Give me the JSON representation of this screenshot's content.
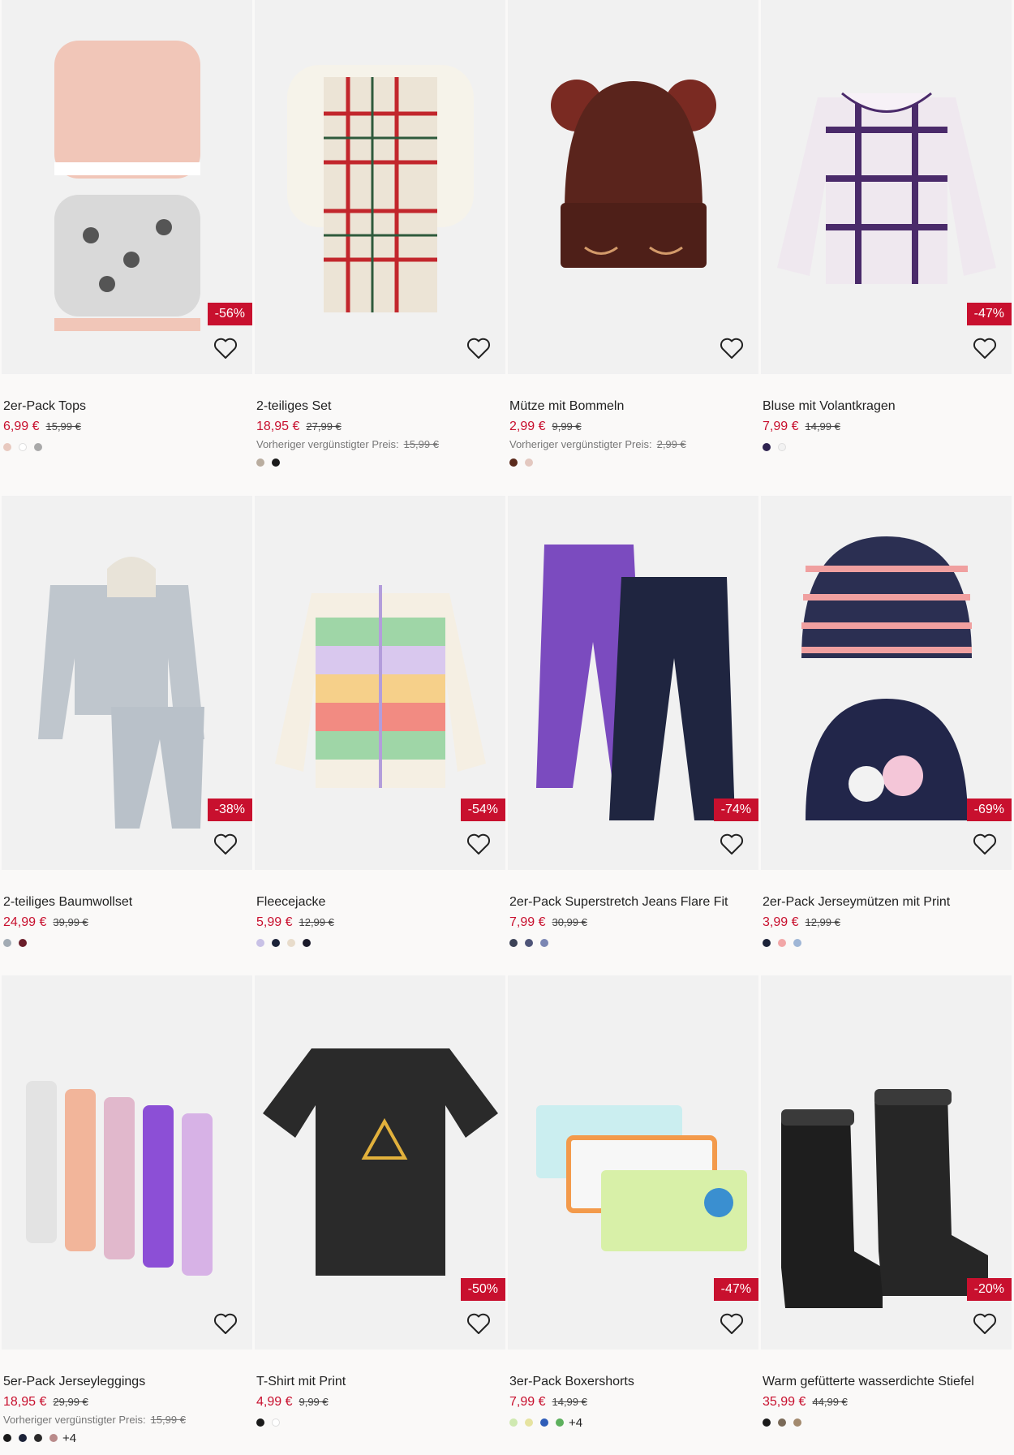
{
  "products": [
    {
      "title": "2er-Pack Tops",
      "price": "6,99 €",
      "old": "15,99 €",
      "prev_label": "",
      "prev_price": "",
      "discount": "-56%",
      "swatches": [
        "#e8c9bf",
        "#ffffff",
        "#a9a9a9"
      ],
      "more": ""
    },
    {
      "title": "2-teiliges Set",
      "price": "18,95 €",
      "old": "27,99 €",
      "prev_label": "Vorheriger vergünstigter Preis:",
      "prev_price": "15,99 €",
      "discount": "",
      "swatches": [
        "#b9ad9f",
        "#1a1a1a"
      ],
      "more": ""
    },
    {
      "title": "Mütze mit Bommeln",
      "price": "2,99 €",
      "old": "9,99 €",
      "prev_label": "Vorheriger vergünstigter Preis:",
      "prev_price": "2,99 €",
      "discount": "",
      "swatches": [
        "#5a2a1c",
        "#e3c8c0"
      ],
      "more": ""
    },
    {
      "title": "Bluse mit Volantkragen",
      "price": "7,99 €",
      "old": "14,99 €",
      "prev_label": "",
      "prev_price": "",
      "discount": "-47%",
      "swatches": [
        "#2e2350",
        "#f2f2f2"
      ],
      "more": ""
    },
    {
      "title": "2-teiliges Baumwollset",
      "price": "24,99 €",
      "old": "39,99 €",
      "prev_label": "",
      "prev_price": "",
      "discount": "-38%",
      "swatches": [
        "#a2abb4",
        "#6b1e2a"
      ],
      "more": ""
    },
    {
      "title": "Fleecejacke",
      "price": "5,99 €",
      "old": "12,99 €",
      "prev_label": "",
      "prev_price": "",
      "discount": "-54%",
      "swatches": [
        "#c8c1e6",
        "#1b2238",
        "#e8dccb",
        "#1a1a2a"
      ],
      "more": ""
    },
    {
      "title": "2er-Pack Superstretch Jeans Flare Fit",
      "price": "7,99 €",
      "old": "30,99 €",
      "prev_label": "",
      "prev_price": "",
      "discount": "-74%",
      "swatches": [
        "#3c4257",
        "#4e5478",
        "#7a86b3"
      ],
      "more": ""
    },
    {
      "title": "2er-Pack Jerseymützen mit Print",
      "price": "3,99 €",
      "old": "12,99 €",
      "prev_label": "",
      "prev_price": "",
      "discount": "-69%",
      "swatches": [
        "#1b2238",
        "#f2a7a8",
        "#9fb6d6"
      ],
      "more": ""
    },
    {
      "title": "5er-Pack Jerseyleggings",
      "price": "18,95 €",
      "old": "29,99 €",
      "prev_label": "Vorheriger vergünstigter Preis:",
      "prev_price": "15,99 €",
      "discount": "",
      "swatches": [
        "#1a1a1a",
        "#1b2238",
        "#2a2a2a",
        "#b98a8a"
      ],
      "more": "+4"
    },
    {
      "title": "T-Shirt mit Print",
      "price": "4,99 €",
      "old": "9,99 €",
      "prev_label": "",
      "prev_price": "",
      "discount": "-50%",
      "swatches": [
        "#1a1a1a",
        "#ffffff"
      ],
      "more": ""
    },
    {
      "title": "3er-Pack Boxershorts",
      "price": "7,99 €",
      "old": "14,99 €",
      "prev_label": "",
      "prev_price": "",
      "discount": "-47%",
      "swatches": [
        "#cfe9b0",
        "#e6e3a0",
        "#2f5db8",
        "#5db05d"
      ],
      "more": "+4"
    },
    {
      "title": "Warm gefütterte wasserdichte Stiefel",
      "price": "35,99 €",
      "old": "44,99 €",
      "prev_label": "",
      "prev_price": "",
      "discount": "-20%",
      "swatches": [
        "#1a1a1a",
        "#7a6a58",
        "#a38a6e"
      ],
      "more": ""
    }
  ],
  "colors": {
    "sale_red": "#c8102e",
    "background": "#faf9f8",
    "image_bg": "#f1f1f1"
  },
  "icons": {
    "favorite": "heart-outline-icon"
  }
}
